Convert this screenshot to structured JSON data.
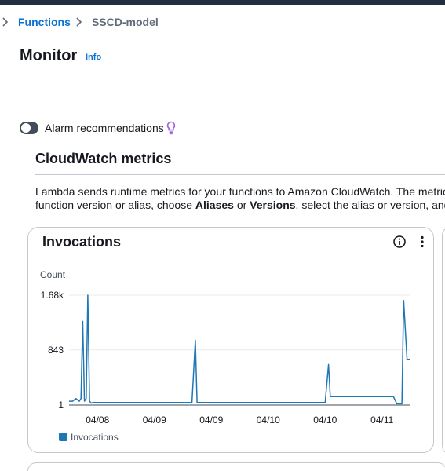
{
  "breadcrumb": {
    "functions": "Functions",
    "current": "SSCD-model"
  },
  "page": {
    "title": "Monitor",
    "info": "Info"
  },
  "alarm": {
    "label": "Alarm recommendations"
  },
  "section": {
    "title": "CloudWatch metrics",
    "description_line1": "Lambda sends runtime metrics for your functions to Amazon CloudWatch. The metric",
    "description_line2_pre": "function version or alias, choose ",
    "description_aliases": "Aliases",
    "description_or": " or ",
    "description_versions": "Versions",
    "description_line2_post": ", select the alias or version, and"
  },
  "icons": {
    "info": "info-circle-icon",
    "more": "more-vertical-icon",
    "bulb": "lightbulb-icon",
    "chevron": "chevron-right-icon"
  },
  "colors": {
    "accent": "#0972d3",
    "series": "#1f77b4",
    "toggle_off": "#414d5c"
  },
  "chart_data": {
    "type": "line",
    "title": "Invocations",
    "ylabel": "Count",
    "ytick_labels": [
      "1.68k",
      "843",
      "1"
    ],
    "yticks": [
      1680,
      843,
      1
    ],
    "ylim": [
      1,
      1680
    ],
    "xtick_labels": [
      "04/08",
      "04/09",
      "04/09",
      "04/10",
      "04/10",
      "04/11"
    ],
    "grid": true,
    "legend": "bottom-left",
    "series": [
      {
        "name": "Invocations",
        "color": "#1f77b4",
        "x": [
          0,
          0.01,
          0.02,
          0.03,
          0.035,
          0.04,
          0.045,
          0.05,
          0.055,
          0.06,
          0.065,
          0.07,
          0.08,
          0.1,
          0.2,
          0.3,
          0.35,
          0.36,
          0.37,
          0.375,
          0.38,
          0.4,
          0.5,
          0.6,
          0.7,
          0.75,
          0.76,
          0.765,
          0.77,
          0.78,
          0.8,
          0.9,
          0.95,
          0.96,
          0.97,
          0.975,
          0.98,
          0.99,
          1.0
        ],
        "y": [
          60,
          60,
          100,
          60,
          100,
          1280,
          60,
          100,
          1680,
          60,
          30,
          40,
          40,
          40,
          40,
          40,
          40,
          40,
          990,
          40,
          40,
          40,
          40,
          40,
          40,
          40,
          620,
          130,
          130,
          130,
          130,
          130,
          130,
          20,
          20,
          20,
          1600,
          700,
          700
        ]
      }
    ]
  },
  "legend": {
    "label": "Invocations"
  }
}
